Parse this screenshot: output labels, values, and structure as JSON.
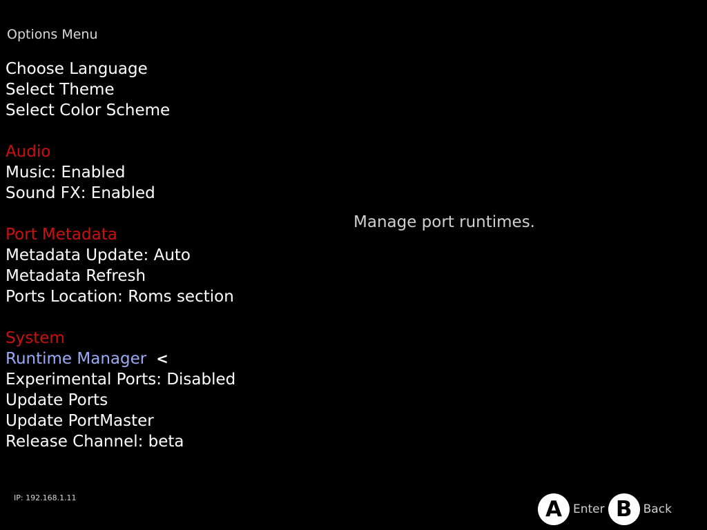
{
  "header": {
    "title": "Options Menu"
  },
  "menu": {
    "items": [
      {
        "label": "Choose Language"
      },
      {
        "label": "Select Theme"
      },
      {
        "label": "Select Color Scheme"
      },
      {
        "label": "Audio"
      },
      {
        "label": "Music: Enabled"
      },
      {
        "label": "Sound FX: Enabled"
      },
      {
        "label": "Port Metadata"
      },
      {
        "label": "Metadata Update: Auto"
      },
      {
        "label": "Metadata Refresh"
      },
      {
        "label": "Ports Location: Roms section"
      },
      {
        "label": "System"
      },
      {
        "label": "Runtime Manager"
      },
      {
        "label": "Experimental Ports: Disabled"
      },
      {
        "label": "Update Ports"
      },
      {
        "label": "Update PortMaster"
      },
      {
        "label": "Release Channel: beta"
      }
    ],
    "cursor": "<"
  },
  "description": "Manage port runtimes.",
  "footer": {
    "ip": "IP: 192.168.1.11",
    "hints": [
      {
        "button": "A",
        "label": "Enter"
      },
      {
        "button": "B",
        "label": "Back"
      }
    ]
  },
  "colors": {
    "background": "#000000",
    "item": "#ffffff",
    "section_header": "#cc1010",
    "selected": "#9aaaf5"
  }
}
